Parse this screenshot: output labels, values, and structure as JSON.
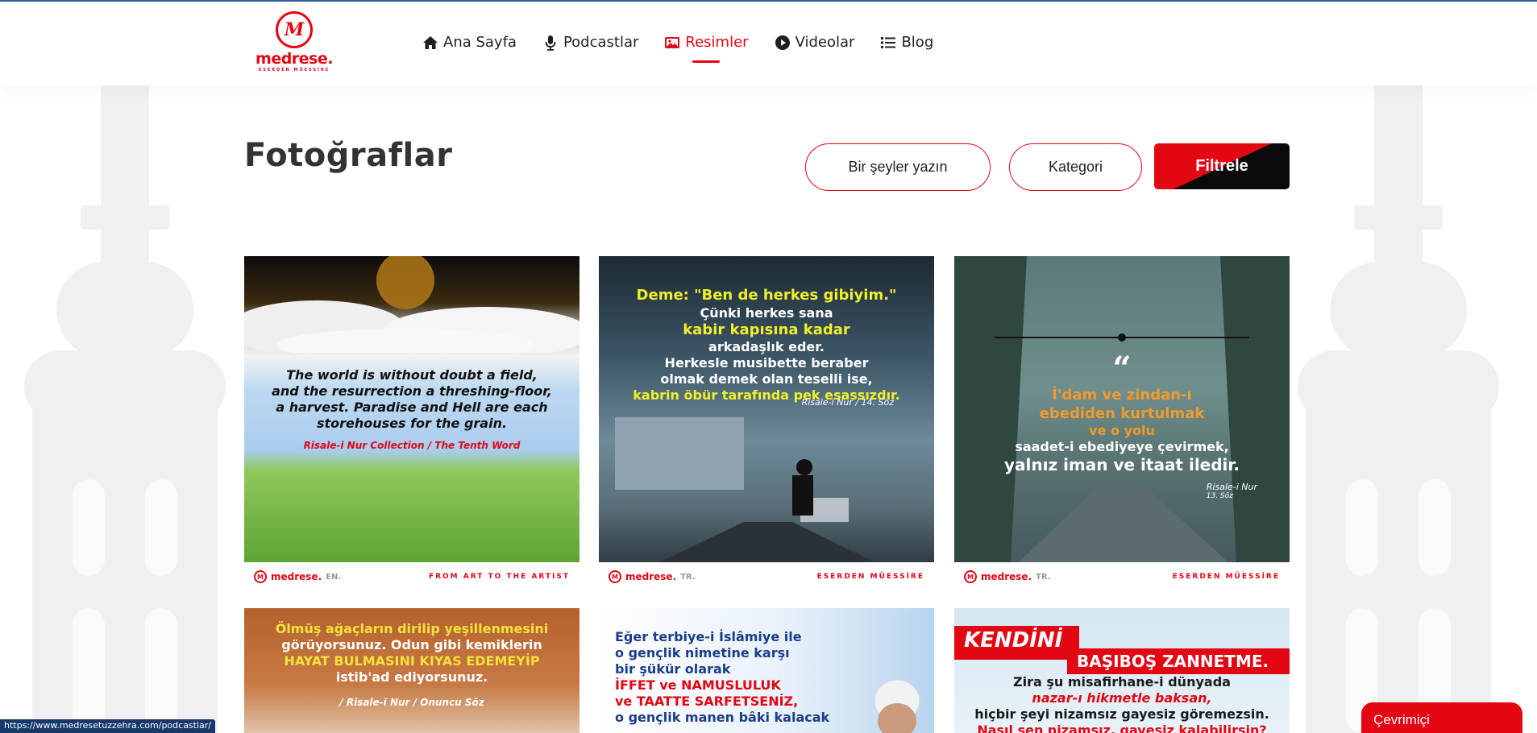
{
  "header": {
    "logo_text": "medrese.",
    "logo_tagline": "ESERDEN MÜESSİRE",
    "nav": [
      {
        "label": "Ana Sayfa",
        "icon": "home-icon"
      },
      {
        "label": "Podcastlar",
        "icon": "microphone-icon"
      },
      {
        "label": "Resimler",
        "icon": "image-icon",
        "active": true
      },
      {
        "label": "Videolar",
        "icon": "play-icon"
      },
      {
        "label": "Blog",
        "icon": "list-icon"
      }
    ]
  },
  "main": {
    "title": "Fotoğraflar",
    "search_placeholder": "Bir şeyler yazın",
    "category_label": "Kategori",
    "filter_label": "Filtrele"
  },
  "gallery": [
    {
      "lines": [
        "The world is without doubt a field,",
        "and the resurrection a threshing-floor,",
        "a harvest. Paradise and Hell are each",
        "storehouses for the grain."
      ],
      "source": "Risale-i Nur Collection / The Tenth Word",
      "brand": "medrese.",
      "brand_suffix": "EN.",
      "slogan": "FROM ART TO THE ARTIST"
    },
    {
      "lines": [
        "Deme: \"Ben de herkes gibiyim.\"",
        "Çünki herkes sana",
        "kabir kapısına kadar",
        "arkadaşlık eder.",
        "Herkesle musibette beraber",
        "olmak demek olan teselli ise,",
        "kabrin öbür tarafında pek esassızdır."
      ],
      "source": "Risale-i Nur / 14. Söz",
      "brand": "medrese.",
      "brand_suffix": "TR.",
      "slogan": "ESERDEN MÜESSİRE"
    },
    {
      "lines": [
        "İ'dam ve zindan-ı",
        "ebediden kurtulmak",
        "ve o yolu",
        "saadet-i ebediyeye çevirmek,",
        "yalnız iman ve itaat iledir."
      ],
      "source": "Risale-i Nur",
      "source2": "13. Söz",
      "brand": "medrese.",
      "brand_suffix": "TR.",
      "slogan": "ESERDEN MÜESSİRE"
    },
    {
      "lines": [
        "Ölmüş ağaçların dirilip yeşillenmesini",
        "görüyorsunuz. Odun gibi kemiklerin",
        "HAYAT BULMASINI KIYAS EDEMEYİP",
        "istib'ad ediyorsunuz."
      ],
      "source": "/ Risale-i Nur / Onuncu Söz"
    },
    {
      "lines": [
        "Eğer terbiye-i İslâmiye ile",
        "o gençlik nimetine karşı",
        "bir şükür olarak",
        "İFFET ve NAMUSLULUK",
        "ve TAATTE SARFETSENİZ,",
        "o gençlik manen bâki kalacak"
      ]
    },
    {
      "header1": "KENDİNİ",
      "header2": "BAŞIBOŞ ZANNETME.",
      "lines": [
        "Zira şu misafirhane-i dünyada",
        "nazar-ı hikmetle baksan,",
        "hiçbir şeyi nizamsız gayesiz göremezsin.",
        "Nasıl sen nizamsız, gayesiz kalabilirsin?"
      ]
    }
  ],
  "status_url": "https://www.medresetuzzehra.com/podcastlar/",
  "chat": {
    "label": "Çevrimiçi"
  }
}
